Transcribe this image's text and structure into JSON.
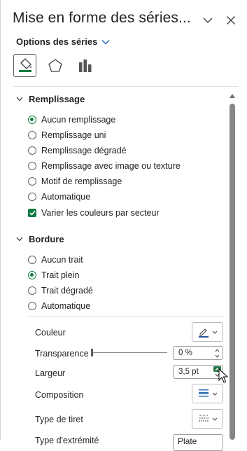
{
  "pane": {
    "title": "Mise en forme des séries...",
    "options_label": "Options des séries",
    "tabs": [
      "paint-bucket-icon",
      "pentagon-icon",
      "bar-chart-icon"
    ]
  },
  "fill": {
    "section_label": "Remplissage",
    "options": [
      {
        "label": "Aucun remplissage",
        "selected": true
      },
      {
        "label": "Remplissage uni",
        "selected": false
      },
      {
        "label": "Remplissage dégradé",
        "selected": false
      },
      {
        "label": "Remplissage avec image ou texture",
        "selected": false
      },
      {
        "label": "Motif de remplissage",
        "selected": false
      },
      {
        "label": "Automatique",
        "selected": false
      }
    ],
    "vary_colors_label": "Varier les couleurs par secteur",
    "vary_colors_checked": true
  },
  "border": {
    "section_label": "Bordure",
    "options": [
      {
        "label": "Aucun trait",
        "selected": false
      },
      {
        "label": "Trait plein",
        "selected": true
      },
      {
        "label": "Trait dégradé",
        "selected": false
      },
      {
        "label": "Automatique",
        "selected": false
      }
    ],
    "color_label": "Couleur",
    "transparency_label": "Transparence",
    "transparency_value": "0 %",
    "transparency_level": 0,
    "width_label": "Largeur",
    "width_value": "3,5 pt",
    "composition_label": "Composition",
    "dash_label": "Type de tiret",
    "cap_label": "Type d'extrémité",
    "cap_value": "Plate"
  },
  "colors": {
    "accent": "#107c41",
    "spin_active": "#217346",
    "pen_color": "#2b5797"
  }
}
